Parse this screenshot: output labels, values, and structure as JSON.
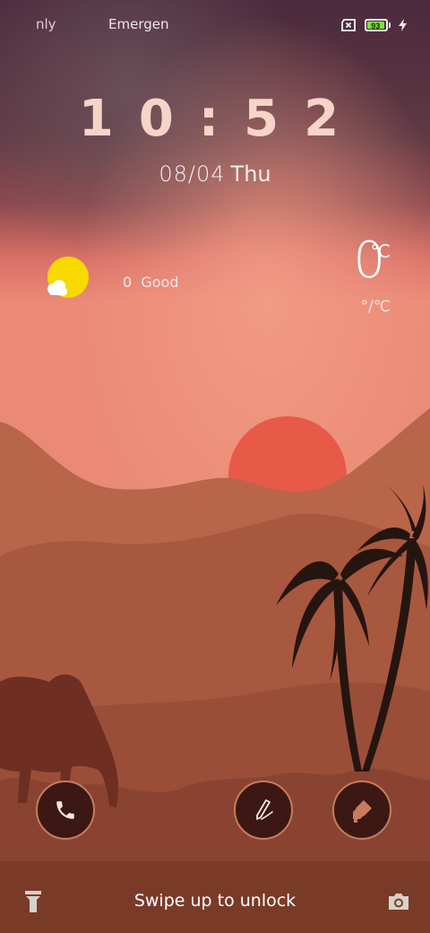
{
  "status_bar": {
    "carrier_primary": "nly",
    "carrier_secondary": "Emergen",
    "battery_level": "93",
    "battery_percent": 93,
    "charging": true,
    "sim_icon": "no-sim-icon",
    "charging_icon": "lightning-icon"
  },
  "clock": {
    "time": "10:52",
    "date": "08/04",
    "weekday": "Thu"
  },
  "weather": {
    "icon": "sun-cloud-icon",
    "aqi_value": "0",
    "aqi_label": "Good",
    "temperature": "0",
    "unit": "℃",
    "unit_toggle": "°/℃"
  },
  "shortcuts": {
    "left": "phone-icon",
    "middle": "pen-icon",
    "right": "eraser-icon"
  },
  "bottom": {
    "unlock_hint": "Swipe up to unlock",
    "left_icon": "flashlight-icon",
    "right_icon": "camera-icon"
  },
  "colors": {
    "sky_top": "#4b2a3c",
    "sky_glow": "#e88472",
    "sun": "#e85a48",
    "dune_far": "#b9654a",
    "dune_mid": "#a8583f",
    "foreground": "#7e3a28",
    "silhouette": "#251510",
    "camel": "#6e2e22",
    "button_ring": "#c77b5c",
    "battery_green": "#7ee03a"
  }
}
